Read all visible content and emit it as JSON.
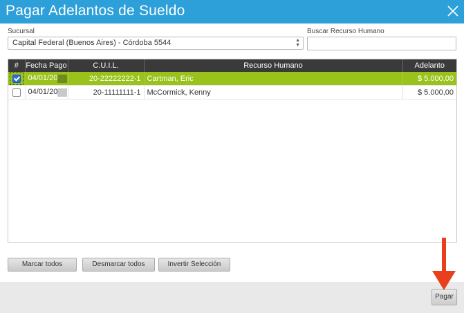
{
  "dialog": {
    "title": "Pagar Adelantos de Sueldo",
    "close_icon": "close-icon"
  },
  "filters": {
    "branch_label": "Sucursal",
    "branch_value": "Capital Federal (Buenos Aires) - Córdoba 5544",
    "search_label": "Buscar Recurso Humano",
    "search_value": ""
  },
  "table": {
    "columns": [
      "#",
      "Fecha Pago",
      "C.U.I.L.",
      "Recurso Humano",
      "Adelanto"
    ],
    "rows": [
      {
        "selected": true,
        "date": "04/01/20",
        "cuil": "20-22222222-1",
        "name": "Cartman, Eric",
        "amount": "$ 5.000,00"
      },
      {
        "selected": false,
        "date": "04/01/20",
        "cuil": "20-11111111-1",
        "name": "McCormick, Kenny",
        "amount": "$ 5.000,00"
      }
    ]
  },
  "actions": {
    "select_all": "Marcar todos",
    "deselect_all": "Desmarcar todos",
    "invert": "Invertir Selección",
    "pay": "Pagar"
  },
  "colors": {
    "titlebar": "#2d9fd9",
    "selected_row": "#99c21b",
    "header": "#3a3a3a",
    "annotation_arrow": "#e8401c"
  }
}
